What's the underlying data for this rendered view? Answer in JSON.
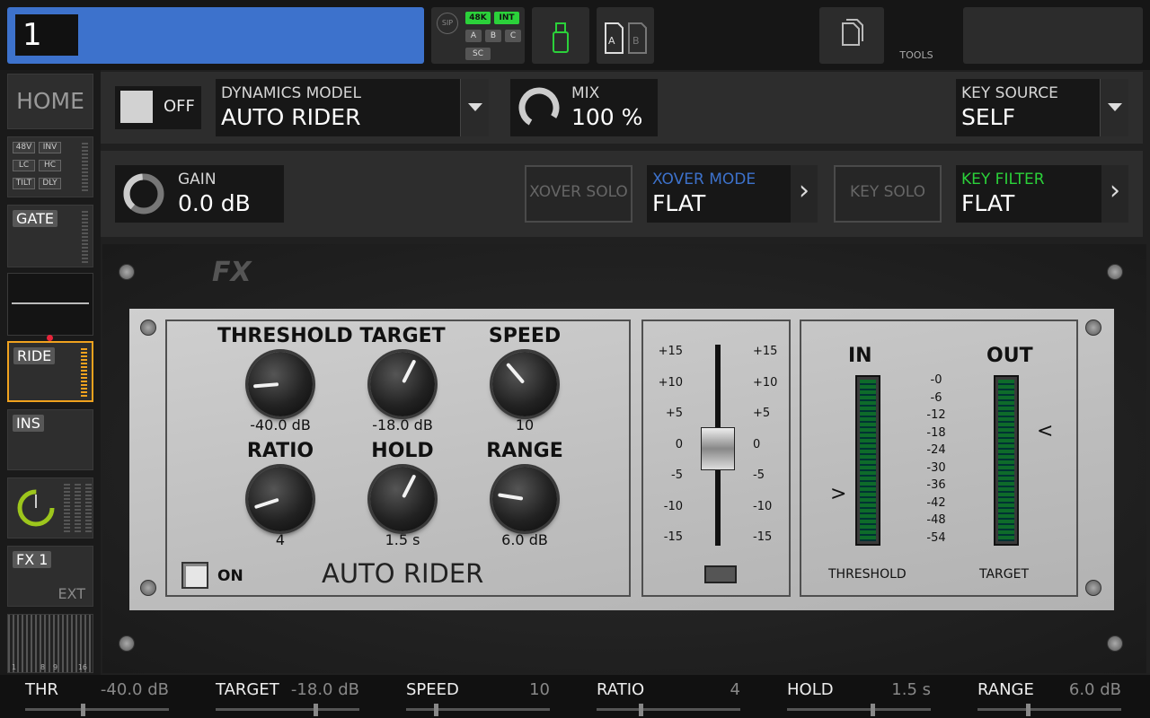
{
  "header": {
    "channel_number": "1",
    "sip": "SIP",
    "rate": "48K",
    "clock": "INT",
    "slot_a": "A",
    "slot_b": "B",
    "slot_c": "C",
    "slot_sc": "SC",
    "card_a": "A",
    "card_b": "B",
    "tools_label": "TOOLS"
  },
  "sidebar": {
    "home": "HOME",
    "phantom": "48V",
    "invert": "INV",
    "low_cut": "LC",
    "high_cut": "HC",
    "tilt": "TILT",
    "delay": "DLY",
    "gate": "GATE",
    "ride": "RIDE",
    "ins": "INS",
    "fx1": "FX 1",
    "fx_ext": "EXT",
    "route_1": "1",
    "route_8": "8",
    "route_9": "9",
    "route_16": "16"
  },
  "controls": {
    "on_state": "OFF",
    "model_caption": "DYNAMICS MODEL",
    "model_value": "AUTO RIDER",
    "mix_caption": "MIX",
    "mix_value": "100 %",
    "key_source_caption": "KEY SOURCE",
    "key_source_value": "SELF",
    "gain_caption": "GAIN",
    "gain_value": "0.0 dB",
    "xover_solo": "XOVER SOLO",
    "xover_mode_caption": "XOVER MODE",
    "xover_mode_value": "FLAT",
    "key_solo": "KEY SOLO",
    "key_filter_caption": "KEY FILTER",
    "key_filter_value": "FLAT",
    "accent_blue": "#3d72cc",
    "accent_green": "#2bd13a"
  },
  "plugin": {
    "logo": "FX",
    "name": "AUTO RIDER",
    "on_label": "ON",
    "knobs": [
      {
        "label": "THRESHOLD",
        "value": "-40.0 dB",
        "level": 0.15
      },
      {
        "label": "TARGET",
        "value": "-18.0 dB",
        "level": 0.6
      },
      {
        "label": "SPEED",
        "value": "10",
        "level": 0.35
      },
      {
        "label": "RATIO",
        "value": "4",
        "level": 0.1
      },
      {
        "label": "HOLD",
        "value": "1.5 s",
        "level": 0.6
      },
      {
        "label": "RANGE",
        "value": "6.0 dB",
        "level": 0.2
      }
    ],
    "fader_scale": [
      "+15",
      "+10",
      "+5",
      "0",
      "-5",
      "-10",
      "-15"
    ],
    "meter_in": "IN",
    "meter_out": "OUT",
    "meter_scale": [
      "-0",
      "-6",
      "-12",
      "-18",
      "-24",
      "-30",
      "-36",
      "-42",
      "-48",
      "-54"
    ],
    "threshold_label": "THRESHOLD",
    "target_label": "TARGET",
    "threshold_marker": ">",
    "target_marker": "<"
  },
  "bottom": [
    {
      "name": "THR",
      "value": "-40.0 dB",
      "level": 0.4
    },
    {
      "name": "TARGET",
      "value": "-18.0 dB",
      "level": 0.7
    },
    {
      "name": "SPEED",
      "value": "10",
      "level": 0.2
    },
    {
      "name": "RATIO",
      "value": "4",
      "level": 0.3
    },
    {
      "name": "HOLD",
      "value": "1.5 s",
      "level": 0.6
    },
    {
      "name": "RANGE",
      "value": "6.0 dB",
      "level": 0.35
    }
  ]
}
